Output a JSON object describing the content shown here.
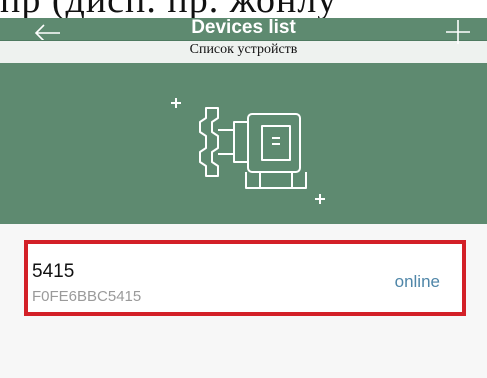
{
  "header": {
    "title": "Devices list",
    "subtitle": "Список устройств",
    "top_strip_text": "пр (дисп. пр. жонлу",
    "back_icon": "arrow-left-icon",
    "add_icon": "plus-icon",
    "background_color": "#5e8a70"
  },
  "illustration": {
    "icon": "circulation-pump-icon"
  },
  "devices": [
    {
      "name": "5415",
      "id": "F0FE6BBC5415",
      "status": "online",
      "status_color": "#4f86a8"
    }
  ]
}
